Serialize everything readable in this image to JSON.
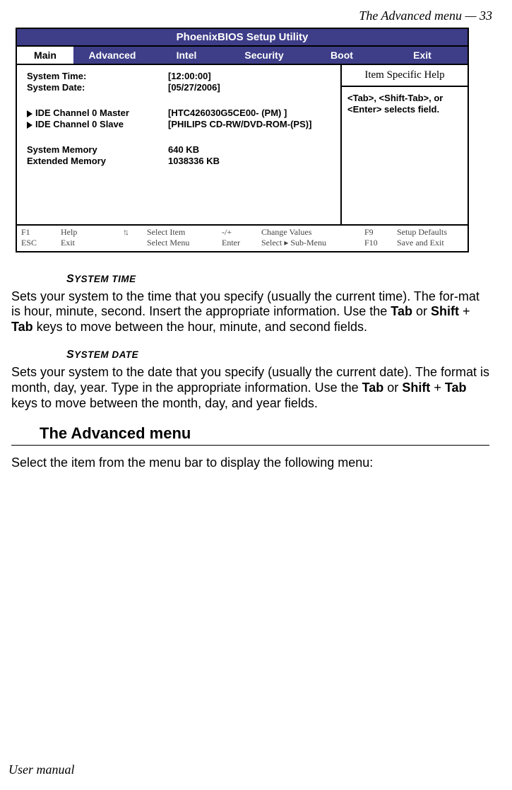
{
  "header": {
    "running": "The Advanced menu —  33"
  },
  "bios": {
    "title": "PhoenixBIOS Setup Utility",
    "tabs": {
      "main": "Main",
      "advanced": "Advanced",
      "intel": "Intel",
      "security": "Security",
      "boot": "Boot",
      "exit": "Exit"
    },
    "rows": {
      "time_label": "System Time:",
      "time_value": "[12:00:00]",
      "date_label": "System Date:",
      "date_value": "[05/27/2006]",
      "ide_master_label": "IDE Channel 0 Master",
      "ide_master_value": "[HTC426030G5CE00- (PM) ]",
      "ide_slave_label": "IDE Channel 0 Slave",
      "ide_slave_value": "[PHILIPS CD-RW/DVD-ROM-(PS)]",
      "sysmem_label": "System Memory",
      "sysmem_value": "640 KB",
      "extmem_label": "Extended Memory",
      "extmem_value": "1038336 KB"
    },
    "help": {
      "title": "Item Specific Help",
      "body": "<Tab>, <Shift-Tab>, or <Enter> selects field."
    },
    "footer": {
      "r1": {
        "c1": "F1",
        "c2": "Help",
        "c3": "",
        "c4": "Select Item",
        "c5": "-/+",
        "c6": "Change Values",
        "c7": "F9",
        "c8": "Setup Defaults"
      },
      "r2": {
        "c1": "ESC",
        "c2": "Exit",
        "c3": "",
        "c4": "Select Menu",
        "c5": "Enter",
        "c6": "Select ▸ Sub-Menu",
        "c7": "F10",
        "c8": "Save and Exit"
      }
    }
  },
  "sections": {
    "systime_head_first": "S",
    "systime_head_rest": "YSTEM TIME",
    "systime_para_a": "Sets your system to the time that you specify (usually the current time). The for-mat is hour, minute, second. Insert the appropriate information. Use the ",
    "systime_para_b": " or ",
    "systime_para_c": " + ",
    "systime_para_d": " keys to move between the hour, minute, and second fields.",
    "kw_tab": "Tab",
    "kw_shift": "Shift",
    "sysdate_head_first": "S",
    "sysdate_head_rest": "YSTEM DATE",
    "sysdate_para_a": "Sets your system to the date that you specify (usually the current date). The format is month, day, year. Type in the appropriate information. Use the ",
    "sysdate_para_b": " or ",
    "sysdate_para_c": " + ",
    "sysdate_para_d": " keys to move between the month, day, and year fields.",
    "adv_heading": "The Advanced menu",
    "adv_para": "Select the item from the menu bar to display the following menu:"
  },
  "footer": {
    "left": "User manual"
  }
}
